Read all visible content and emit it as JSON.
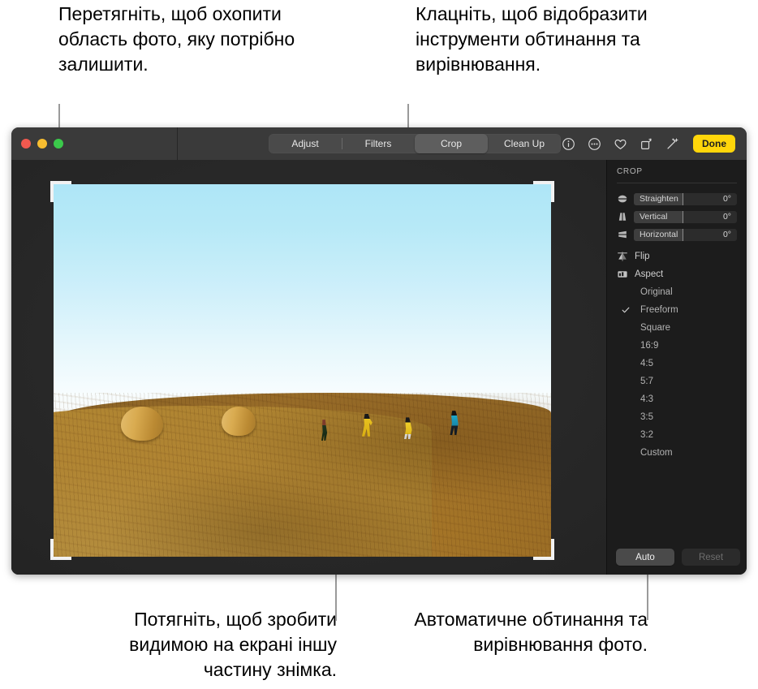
{
  "callouts": {
    "top_left": "Перетягніть, щоб охопити область фото, яку потрібно залишити.",
    "top_right": "Клацніть, щоб відобразити інструменти обтинання та вирівнювання.",
    "bottom_left": "Потягніть, щоб зробити видимою на екрані іншу частину знімка.",
    "bottom_right": "Автоматичне обтинання та вирівнювання фото."
  },
  "window": {
    "traffic_lights": [
      "close",
      "minimize",
      "zoom"
    ],
    "tabs": [
      {
        "label": "Adjust",
        "active": false
      },
      {
        "label": "Filters",
        "active": false
      },
      {
        "label": "Crop",
        "active": true
      },
      {
        "label": "Clean Up",
        "active": false
      }
    ],
    "toolbar_icons": [
      "info-icon",
      "more-options-icon",
      "favorite-heart-icon",
      "rotate-icon",
      "auto-enhance-wand-icon"
    ],
    "done_label": "Done",
    "done_color": "#ffd60a"
  },
  "panel": {
    "title": "CROP",
    "sliders": [
      {
        "icon": "straighten-icon",
        "label": "Straighten",
        "value": "0°"
      },
      {
        "icon": "vertical-perspective-icon",
        "label": "Vertical",
        "value": "0°"
      },
      {
        "icon": "horizontal-perspective-icon",
        "label": "Horizontal",
        "value": "0°"
      }
    ],
    "tools": [
      {
        "icon": "flip-icon",
        "label": "Flip"
      },
      {
        "icon": "aspect-icon",
        "label": "Aspect"
      }
    ],
    "aspect_options": [
      {
        "label": "Original",
        "selected": false
      },
      {
        "label": "Freeform",
        "selected": true
      },
      {
        "label": "Square",
        "selected": false
      },
      {
        "label": "16:9",
        "selected": false
      },
      {
        "label": "4:5",
        "selected": false
      },
      {
        "label": "5:7",
        "selected": false
      },
      {
        "label": "4:3",
        "selected": false
      },
      {
        "label": "3:5",
        "selected": false
      },
      {
        "label": "3:2",
        "selected": false
      },
      {
        "label": "Custom",
        "selected": false
      }
    ],
    "auto_label": "Auto",
    "reset_label": "Reset"
  },
  "photo": {
    "description": "Four children running along a golden stubble field hilltop under a pale blue sky with two round hay bales",
    "crop_selection": "full-frame"
  }
}
